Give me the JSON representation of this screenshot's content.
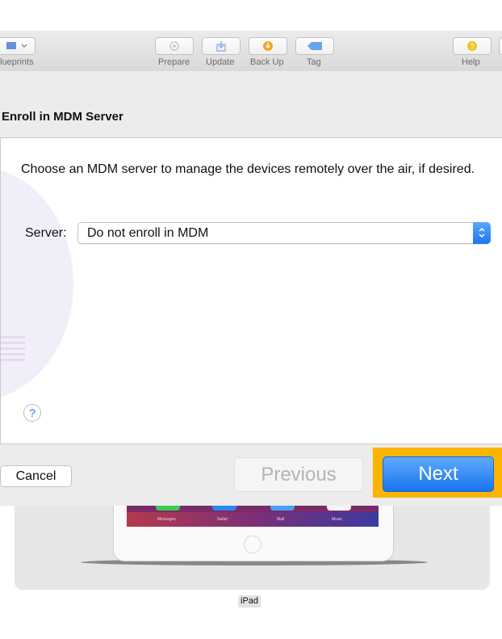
{
  "toolbar": {
    "blueprints_label": "lueprints",
    "prepare_label": "Prepare",
    "update_label": "Update",
    "backup_label": "Back Up",
    "tag_label": "Tag",
    "help_label": "Help"
  },
  "sheet": {
    "title": "Enroll in MDM Server",
    "description": "Choose an MDM server to manage the devices remotely over the air, if desired.",
    "server_label": "Server:",
    "server_value": "Do not enroll in MDM",
    "help_icon": "?",
    "cancel_label": "Cancel",
    "previous_label": "Previous",
    "next_label": "Next"
  },
  "device": {
    "name": "iPad",
    "dock_apps": [
      "Messages",
      "Safari",
      "Mail",
      "Music"
    ]
  },
  "colors": {
    "highlight": "#fbb402",
    "accent": "#1a74ef"
  }
}
